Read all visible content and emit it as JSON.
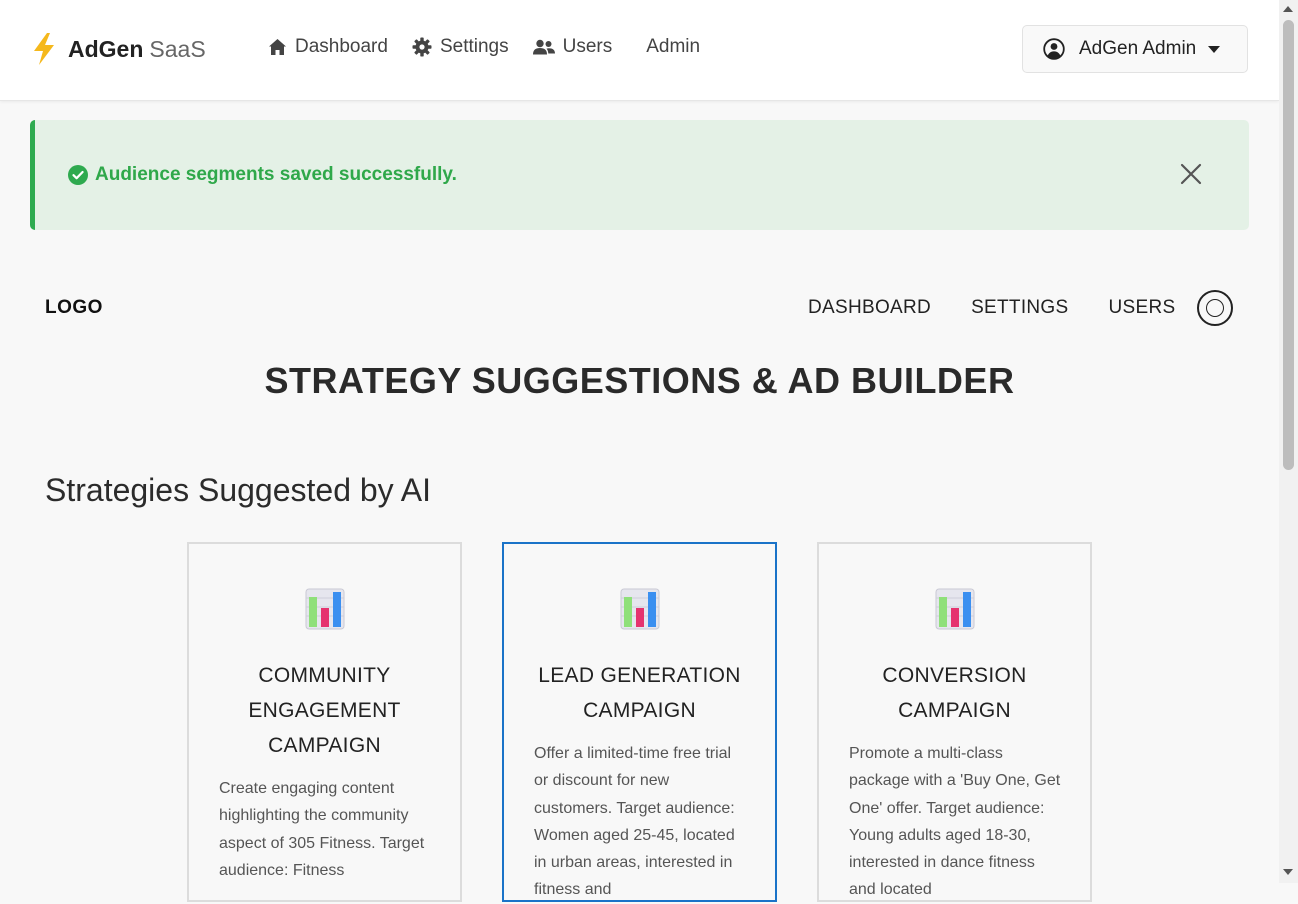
{
  "app": {
    "brand_name": "AdGen",
    "brand_suffix": "SaaS",
    "nav": [
      {
        "label": "Dashboard",
        "icon": "home-icon"
      },
      {
        "label": "Settings",
        "icon": "gear-icon"
      },
      {
        "label": "Users",
        "icon": "users-icon"
      },
      {
        "label": "Admin"
      }
    ],
    "user_menu": {
      "label": "AdGen Admin",
      "icon": "user-circle-icon"
    }
  },
  "alert": {
    "message": "Audience segments saved successfully.",
    "icon": "check-circle-icon",
    "color": "#2fa84a"
  },
  "page": {
    "logo": "LOGO",
    "subnav": [
      "DASHBOARD",
      "SETTINGS",
      "USERS"
    ],
    "title": "STRATEGY SUGGESTIONS & AD BUILDER",
    "section_title": "Strategies Suggested by AI"
  },
  "cards": [
    {
      "title": "COMMUNITY ENGAGEMENT CAMPAIGN",
      "description": "Create engaging content highlighting the community aspect of 305 Fitness. Target audience: Fitness",
      "selected": false,
      "icon": "bar-chart-icon"
    },
    {
      "title": "LEAD GENERATION CAMPAIGN",
      "description": "Offer a limited-time free trial or discount for new customers. Target audience: Women aged 25-45, located in urban areas, interested in fitness and",
      "selected": true,
      "icon": "bar-chart-icon"
    },
    {
      "title": "CONVERSION CAMPAIGN",
      "description": "Promote a multi-class package with a 'Buy One, Get One' offer. Target audience: Young adults aged 18-30, interested in dance fitness and located",
      "selected": false,
      "icon": "bar-chart-icon"
    }
  ],
  "colors": {
    "accent": "#1a73c8",
    "success": "#2eaa4f",
    "bolt": "#f5b81c"
  }
}
